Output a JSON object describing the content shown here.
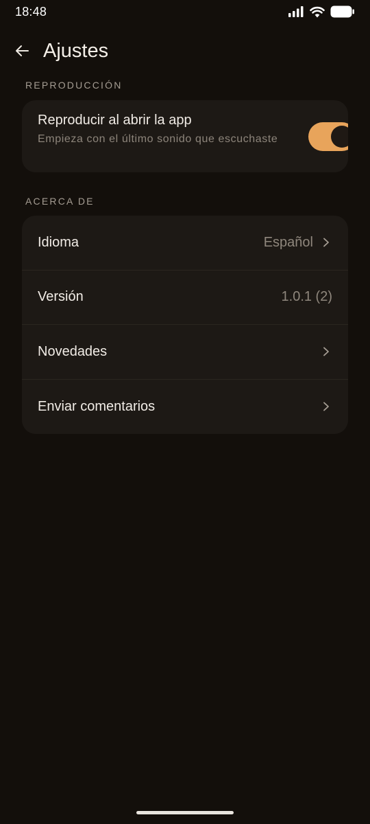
{
  "status_bar": {
    "time": "18:48"
  },
  "app_bar": {
    "title": "Ajustes"
  },
  "sections": {
    "playback": {
      "header": "REPRODUCCIÓN",
      "autoplay": {
        "title": "Reproducir al abrir la app",
        "subtitle": "Empieza con el último sonido que escuchaste",
        "enabled": true
      }
    },
    "about": {
      "header": "ACERCA DE",
      "rows": [
        {
          "label": "Idioma",
          "value": "Español"
        },
        {
          "label": "Versión",
          "value": "1.0.1 (2)"
        },
        {
          "label": "Novedades",
          "value": ""
        },
        {
          "label": "Enviar comentarios",
          "value": ""
        }
      ]
    }
  },
  "colors": {
    "accent": "#e8a45b",
    "background": "#130f0b",
    "card": "#1d1915"
  }
}
